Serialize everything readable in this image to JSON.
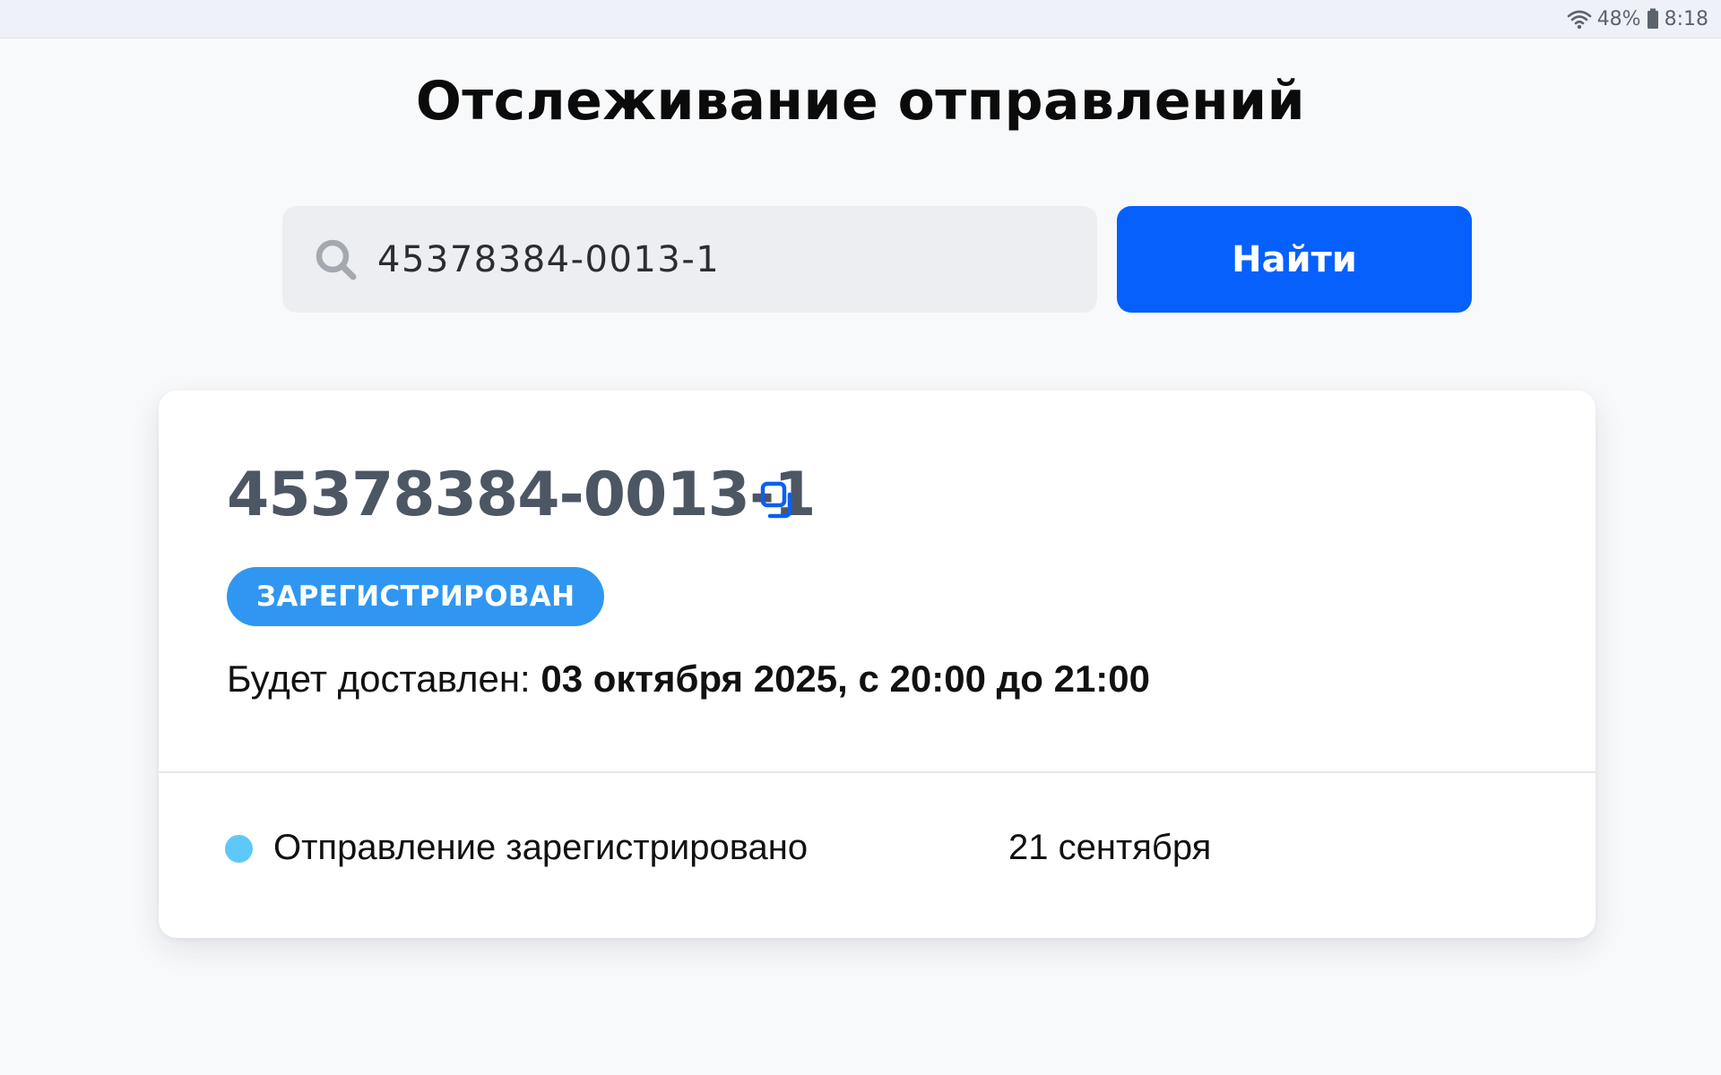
{
  "status_bar": {
    "battery_percent": "48%",
    "time": "8:18",
    "icons": [
      "wifi-icon",
      "battery-icon"
    ]
  },
  "page": {
    "title": "Отслеживание отправлений"
  },
  "search": {
    "value": "45378384-0013-1",
    "button_label": "Найти",
    "icon": "search-icon"
  },
  "shipment": {
    "tracking_number": "45378384-0013-1",
    "copy_icon": "copy-icon",
    "status_label": "ЗАРЕГИСТРИРОВАН",
    "delivery_prefix": "Будет доставлен:",
    "delivery_window": "03 октября 2025, с 20:00 до 21:00",
    "events": [
      {
        "label": "Отправление зарегистрировано",
        "date": "21 сентября"
      }
    ]
  },
  "colors": {
    "accent": "#0560fc",
    "status_badge": "#2f97f1",
    "event_dot": "#5ec8f9",
    "tracking_number_text": "#4d5663",
    "background": "#f8f9fb"
  }
}
